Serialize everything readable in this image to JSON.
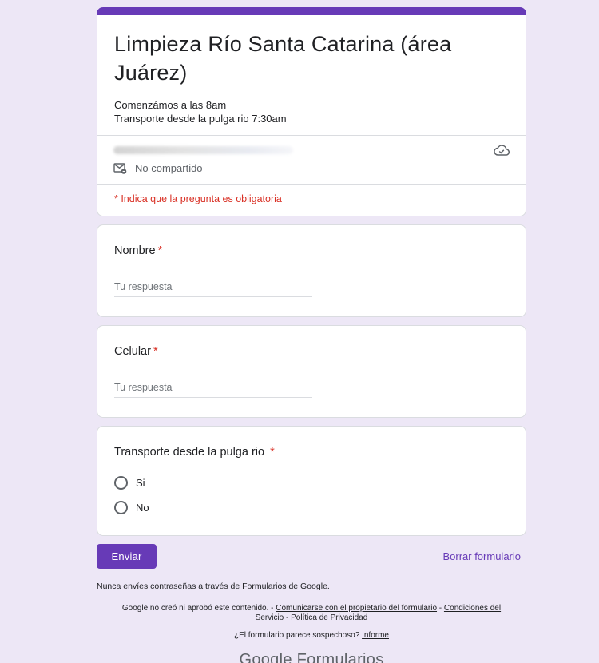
{
  "form": {
    "title": "Limpieza Río Santa Catarina (área Juárez)",
    "description_line1": "Comenzámos a las 8am",
    "description_line2": "Transporte desde la pulga rio 7:30am",
    "share_status": "No compartido",
    "required_note": "* Indica que la pregunta es obligatoria"
  },
  "questions": [
    {
      "title": "Nombre",
      "required_mark": "*",
      "placeholder": "Tu respuesta"
    },
    {
      "title": "Celular",
      "required_mark": "*",
      "placeholder": "Tu respuesta"
    },
    {
      "title": "Transporte desde la pulga rio",
      "required_mark": "*",
      "options": [
        "Si",
        "No"
      ]
    }
  ],
  "actions": {
    "submit_label": "Enviar",
    "clear_label": "Borrar formulario"
  },
  "footer": {
    "password_note": "Nunca envíes contraseñas a través de Formularios de Google.",
    "legal_text": "Google no creó ni aprobó este contenido. - ",
    "contact_link": "Comunicarse con el propietario del formulario",
    "sep1": " - ",
    "terms_link": "Condiciones del Servicio",
    "sep2": " - ",
    "privacy_link": "Política de Privacidad",
    "suspicious_text": "¿El formulario parece sospechoso? ",
    "report_link": "Informe",
    "brand_google": "Google",
    "brand_product": "Formularios"
  },
  "colors": {
    "accent": "#673ab7",
    "background": "#ede7f6",
    "required": "#d93025"
  }
}
